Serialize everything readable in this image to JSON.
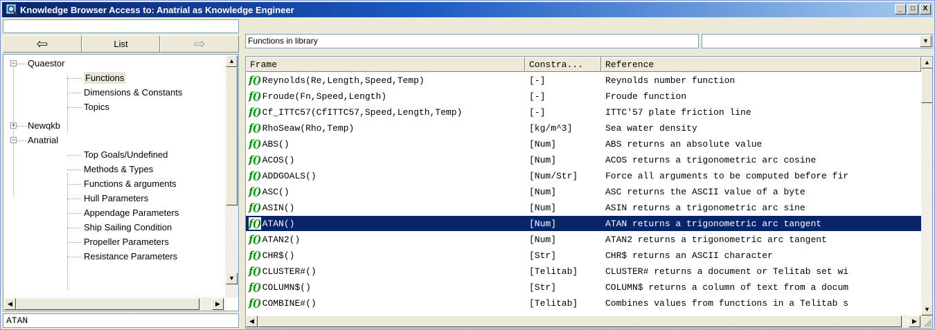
{
  "window": {
    "title": "Knowledge Browser Access to: Anatrial as Knowledge Engineer"
  },
  "controls": {
    "minimize": "_",
    "maximize": "□",
    "close": "X"
  },
  "left": {
    "top_field": "",
    "nav": {
      "back_icon": "⇦",
      "list_label": "List",
      "forward_icon": "⇨"
    },
    "tree": [
      {
        "label": "Quaestor",
        "expander": "−",
        "level": 0
      },
      {
        "label": "Functions",
        "level": 1,
        "selected": true
      },
      {
        "label": "Dimensions & Constants",
        "level": 1
      },
      {
        "label": "Topics",
        "level": 1
      },
      {
        "label": "Newqkb",
        "expander": "+",
        "level": 0
      },
      {
        "label": "Anatrial",
        "expander": "−",
        "level": 0
      },
      {
        "label": "Top Goals/Undefined",
        "level": 1
      },
      {
        "label": "Methods & Types",
        "level": 1
      },
      {
        "label": "Functions & arguments",
        "level": 1
      },
      {
        "label": "Hull Parameters",
        "level": 1
      },
      {
        "label": "Appendage Parameters",
        "level": 1
      },
      {
        "label": "Ship Sailing Condition",
        "level": 1
      },
      {
        "label": "Propeller Parameters",
        "level": 1
      },
      {
        "label": "Resistance Parameters",
        "level": 1
      }
    ],
    "bottom_field": "ATAN"
  },
  "right": {
    "top_field": "Functions in library",
    "combo_value": "",
    "columns": [
      "Frame",
      "Constra...",
      "Reference"
    ],
    "fn_icon": "f()",
    "rows": [
      {
        "frame": "Reynolds(Re,Length,Speed,Temp)",
        "constraint": "[-]",
        "reference": "Reynolds number function"
      },
      {
        "frame": "Froude(Fn,Speed,Length)",
        "constraint": "[-]",
        "reference": "Froude function"
      },
      {
        "frame": "Cf_ITTC57(CfITTC57,Speed,Length,Temp)",
        "constraint": "[-]",
        "reference": "ITTC'57 plate friction line"
      },
      {
        "frame": "RhoSeaw(Rho,Temp)",
        "constraint": "[kg/m^3]",
        "reference": "Sea water density"
      },
      {
        "frame": "ABS()",
        "constraint": "[Num]",
        "reference": "ABS returns an absolute value"
      },
      {
        "frame": "ACOS()",
        "constraint": "[Num]",
        "reference": "ACOS returns a trigonometric arc cosine"
      },
      {
        "frame": "ADDGOALS()",
        "constraint": "[Num/Str]",
        "reference": "Force all arguments to be computed before fir"
      },
      {
        "frame": "ASC()",
        "constraint": "[Num]",
        "reference": "ASC returns the ASCII value of a byte"
      },
      {
        "frame": "ASIN()",
        "constraint": "[Num]",
        "reference": "ASIN returns a trigonometric arc sine"
      },
      {
        "frame": "ATAN()",
        "constraint": "[Num]",
        "reference": "ATAN returns a trigonometric arc tangent",
        "selected": true
      },
      {
        "frame": "ATAN2()",
        "constraint": "[Num]",
        "reference": "ATAN2 returns a trigonometric arc tangent"
      },
      {
        "frame": "CHR$()",
        "constraint": "[Str]",
        "reference": "CHR$ returns an ASCII character"
      },
      {
        "frame": "CLUSTER#()",
        "constraint": "[Telitab]",
        "reference": "CLUSTER# returns a document or Telitab set wi"
      },
      {
        "frame": "COLUMN$()",
        "constraint": "[Str]",
        "reference": "COLUMN$ returns a column of text from a docum"
      },
      {
        "frame": "COMBINE#()",
        "constraint": "[Telitab]",
        "reference": "Combines values from functions in a Telitab s"
      }
    ]
  },
  "scroll": {
    "up": "▲",
    "down": "▼",
    "left": "◀",
    "right": "▶"
  }
}
